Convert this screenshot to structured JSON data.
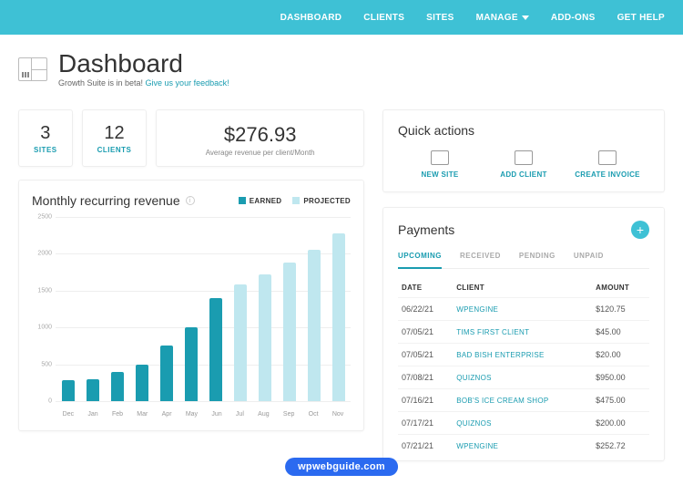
{
  "nav": [
    "DASHBOARD",
    "CLIENTS",
    "SITES",
    "MANAGE",
    "ADD-ONS",
    "GET HELP"
  ],
  "title": "Dashboard",
  "subtitle_prefix": "Growth Suite is in beta! ",
  "subtitle_link": "Give us your feedback!",
  "stats": {
    "sites": {
      "value": "3",
      "label": "SITES"
    },
    "clients": {
      "value": "12",
      "label": "CLIENTS"
    },
    "revenue": {
      "value": "$276.93",
      "label": "Average revenue per client/Month"
    }
  },
  "chart_title": "Monthly recurring revenue",
  "legend": {
    "earned": "EARNED",
    "projected": "PROJECTED"
  },
  "chart_data": {
    "type": "bar",
    "title": "Monthly recurring revenue",
    "xlabel": "",
    "ylabel": "",
    "ylim": [
      0,
      2500
    ],
    "yticks": [
      0,
      500,
      1000,
      1500,
      2000,
      2500
    ],
    "categories": [
      "Dec",
      "Jan",
      "Feb",
      "Mar",
      "Apr",
      "May",
      "Jun",
      "Jul",
      "Aug",
      "Sep",
      "Oct",
      "Nov"
    ],
    "series": [
      {
        "name": "EARNED",
        "color": "#1a9cb0",
        "values": [
          280,
          300,
          400,
          500,
          750,
          1000,
          1400,
          null,
          null,
          null,
          null,
          null
        ]
      },
      {
        "name": "PROJECTED",
        "color": "#bfe7ef",
        "values": [
          null,
          null,
          null,
          null,
          null,
          null,
          null,
          1580,
          1720,
          1880,
          2050,
          2280
        ]
      }
    ]
  },
  "quick_actions": {
    "title": "Quick actions",
    "items": [
      "NEW SITE",
      "ADD CLIENT",
      "CREATE INVOICE"
    ]
  },
  "payments": {
    "title": "Payments",
    "tabs": [
      "UPCOMING",
      "RECEIVED",
      "PENDING",
      "UNPAID"
    ],
    "active_tab": 0,
    "columns": [
      "DATE",
      "CLIENT",
      "AMOUNT"
    ],
    "rows": [
      {
        "date": "06/22/21",
        "client": "WPENGINE",
        "amount": "$120.75"
      },
      {
        "date": "07/05/21",
        "client": "TIMS FIRST CLIENT",
        "amount": "$45.00"
      },
      {
        "date": "07/05/21",
        "client": "BAD BISH ENTERPRISE",
        "amount": "$20.00"
      },
      {
        "date": "07/08/21",
        "client": "QUIZNOS",
        "amount": "$950.00"
      },
      {
        "date": "07/16/21",
        "client": "BOB'S ICE CREAM SHOP",
        "amount": "$475.00"
      },
      {
        "date": "07/17/21",
        "client": "QUIZNOS",
        "amount": "$200.00"
      },
      {
        "date": "07/21/21",
        "client": "WPENGINE",
        "amount": "$252.72"
      }
    ]
  },
  "colors": {
    "earned": "#1a9cb0",
    "projected": "#bfe7ef"
  },
  "badge": "wpwebguide.com"
}
